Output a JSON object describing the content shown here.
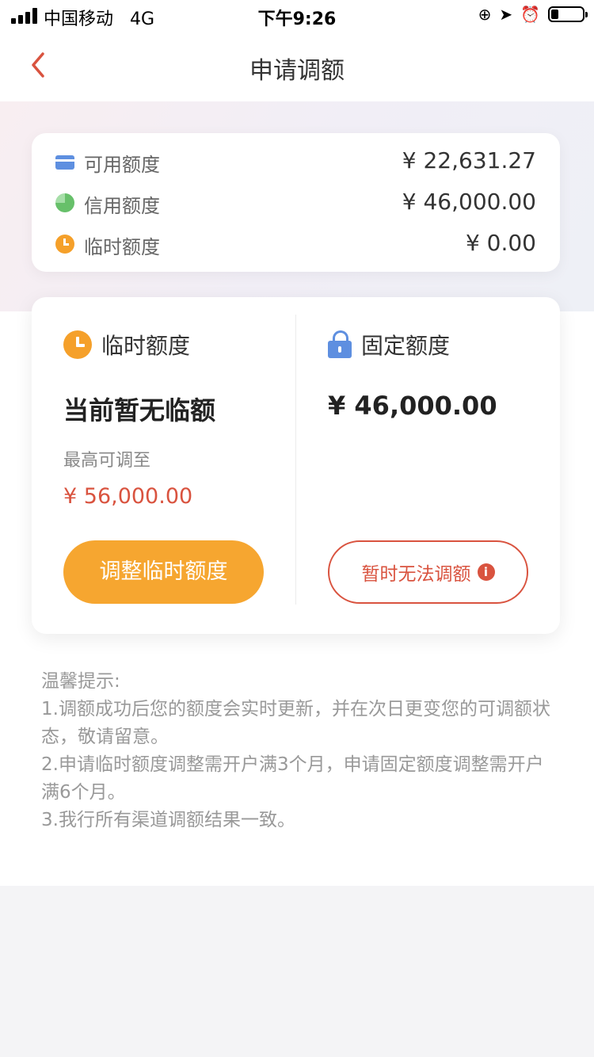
{
  "status_bar": {
    "carrier": "中国移动",
    "network": "4G",
    "time": "下午9:26",
    "battery_level": 0.22
  },
  "nav": {
    "title": "申请调额",
    "back_icon": "chevron-left-icon"
  },
  "summary": {
    "rows": [
      {
        "label": "可用额度",
        "value": "¥ 22,631.27",
        "icon": "card-icon"
      },
      {
        "label": "信用额度",
        "value": "¥ 46,000.00",
        "icon": "pie-icon"
      },
      {
        "label": "临时额度",
        "value": "¥ 0.00",
        "icon": "clock-icon"
      }
    ]
  },
  "temporary": {
    "title": "临时额度",
    "status": "当前暂无临额",
    "max_label": "最高可调至",
    "max_value": "¥ 56,000.00",
    "button_label": "调整临时额度"
  },
  "fixed": {
    "title": "固定额度",
    "value": "¥ 46,000.00",
    "button_label": "暂时无法调额",
    "info_glyph": "i"
  },
  "tips": {
    "title": "温馨提示:",
    "items": [
      "1.调额成功后您的额度会实时更新，并在次日更变您的可调额状态，敬请留意。",
      "2.申请临时额度调整需开户满3个月，申请固定额度调整需开户满6个月。",
      "3.我行所有渠道调额结果一致。"
    ]
  },
  "colors": {
    "accent_orange": "#f6a630",
    "accent_red": "#d9533f",
    "icon_blue": "#5e8fe0",
    "icon_green": "#67c06a"
  }
}
